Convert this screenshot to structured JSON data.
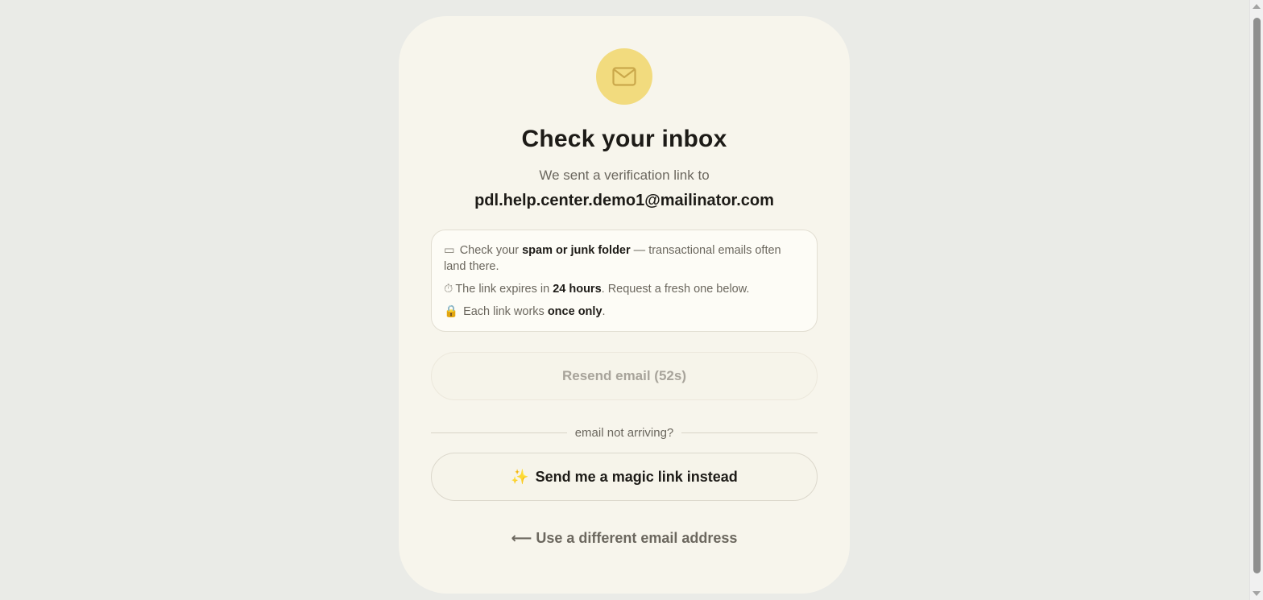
{
  "icon": {
    "name": "envelope-icon",
    "badge_color": "#f2db7e"
  },
  "title": "Check your inbox",
  "subtitle": "We sent a verification link to",
  "email": "pdl.help.center.demo1@mailinator.com",
  "tips": [
    {
      "emoji": "▭",
      "pre": "Check your ",
      "bold": "spam or junk folder",
      "post": " — transactional emails often land there."
    },
    {
      "emoji": "⏱",
      "pre": "The link expires in ",
      "bold": "24 hours",
      "post": ". Request a fresh one below."
    },
    {
      "emoji": "🔒",
      "pre": "Each link works ",
      "bold": "once only",
      "post": "."
    }
  ],
  "resend_label": "Resend email (52s)",
  "divider_label": "email not arriving?",
  "magic_emoji": "✨",
  "magic_label": "Send me a magic link instead",
  "back_label": "⟵ Use a different email address",
  "colors": {
    "background": "#eaebe7",
    "card": "#f7f5ec",
    "accent": "#f2db7e",
    "text": "#1d1b17",
    "muted": "#6b675e"
  }
}
